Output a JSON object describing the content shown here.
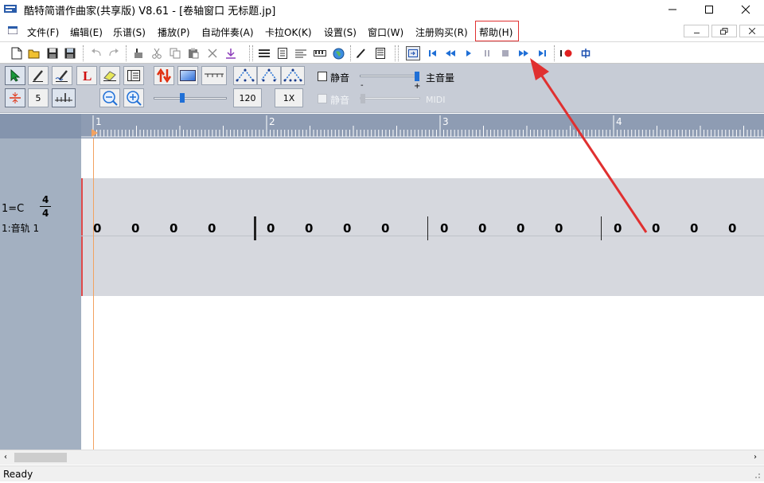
{
  "window": {
    "title": "酷特简谱作曲家(共享版) V8.61 - [卷轴窗口  无标题.jp]"
  },
  "menu": [
    {
      "label": "文件(F)"
    },
    {
      "label": "编辑(E)"
    },
    {
      "label": "乐谱(S)"
    },
    {
      "label": "播放(P)"
    },
    {
      "label": "自动伴奏(A)"
    },
    {
      "label": "卡拉OK(K)"
    },
    {
      "label": "设置(S)"
    },
    {
      "label": "窗口(W)"
    },
    {
      "label": "注册购买(R)"
    },
    {
      "label": "帮助(H)"
    }
  ],
  "toolbar2": {
    "step_value": "5",
    "tempo": "120",
    "speed": "1X",
    "mute_label": "静音",
    "master_volume_label": "主音量",
    "minus": "-",
    "plus": "+",
    "mute2_label": "静音",
    "midi_label": "MIDI"
  },
  "ruler": {
    "measures": [
      "1",
      "2",
      "3",
      "4"
    ]
  },
  "track": {
    "key_label": "1=C",
    "time_sig_top": "4",
    "time_sig_bottom": "4",
    "name": "1:音轨  1"
  },
  "score": {
    "notes": [
      "0",
      "0",
      "0",
      "0",
      "0",
      "0",
      "0",
      "0",
      "0",
      "0",
      "0",
      "0",
      "0",
      "0",
      "0",
      "0"
    ]
  },
  "status": {
    "text": "Ready"
  },
  "colors": {
    "annotation_red": "#e03030",
    "accent_blue": "#1f6fd6",
    "ruler_bg": "#8e9cb3",
    "panel_bg": "#a3b0c1"
  }
}
